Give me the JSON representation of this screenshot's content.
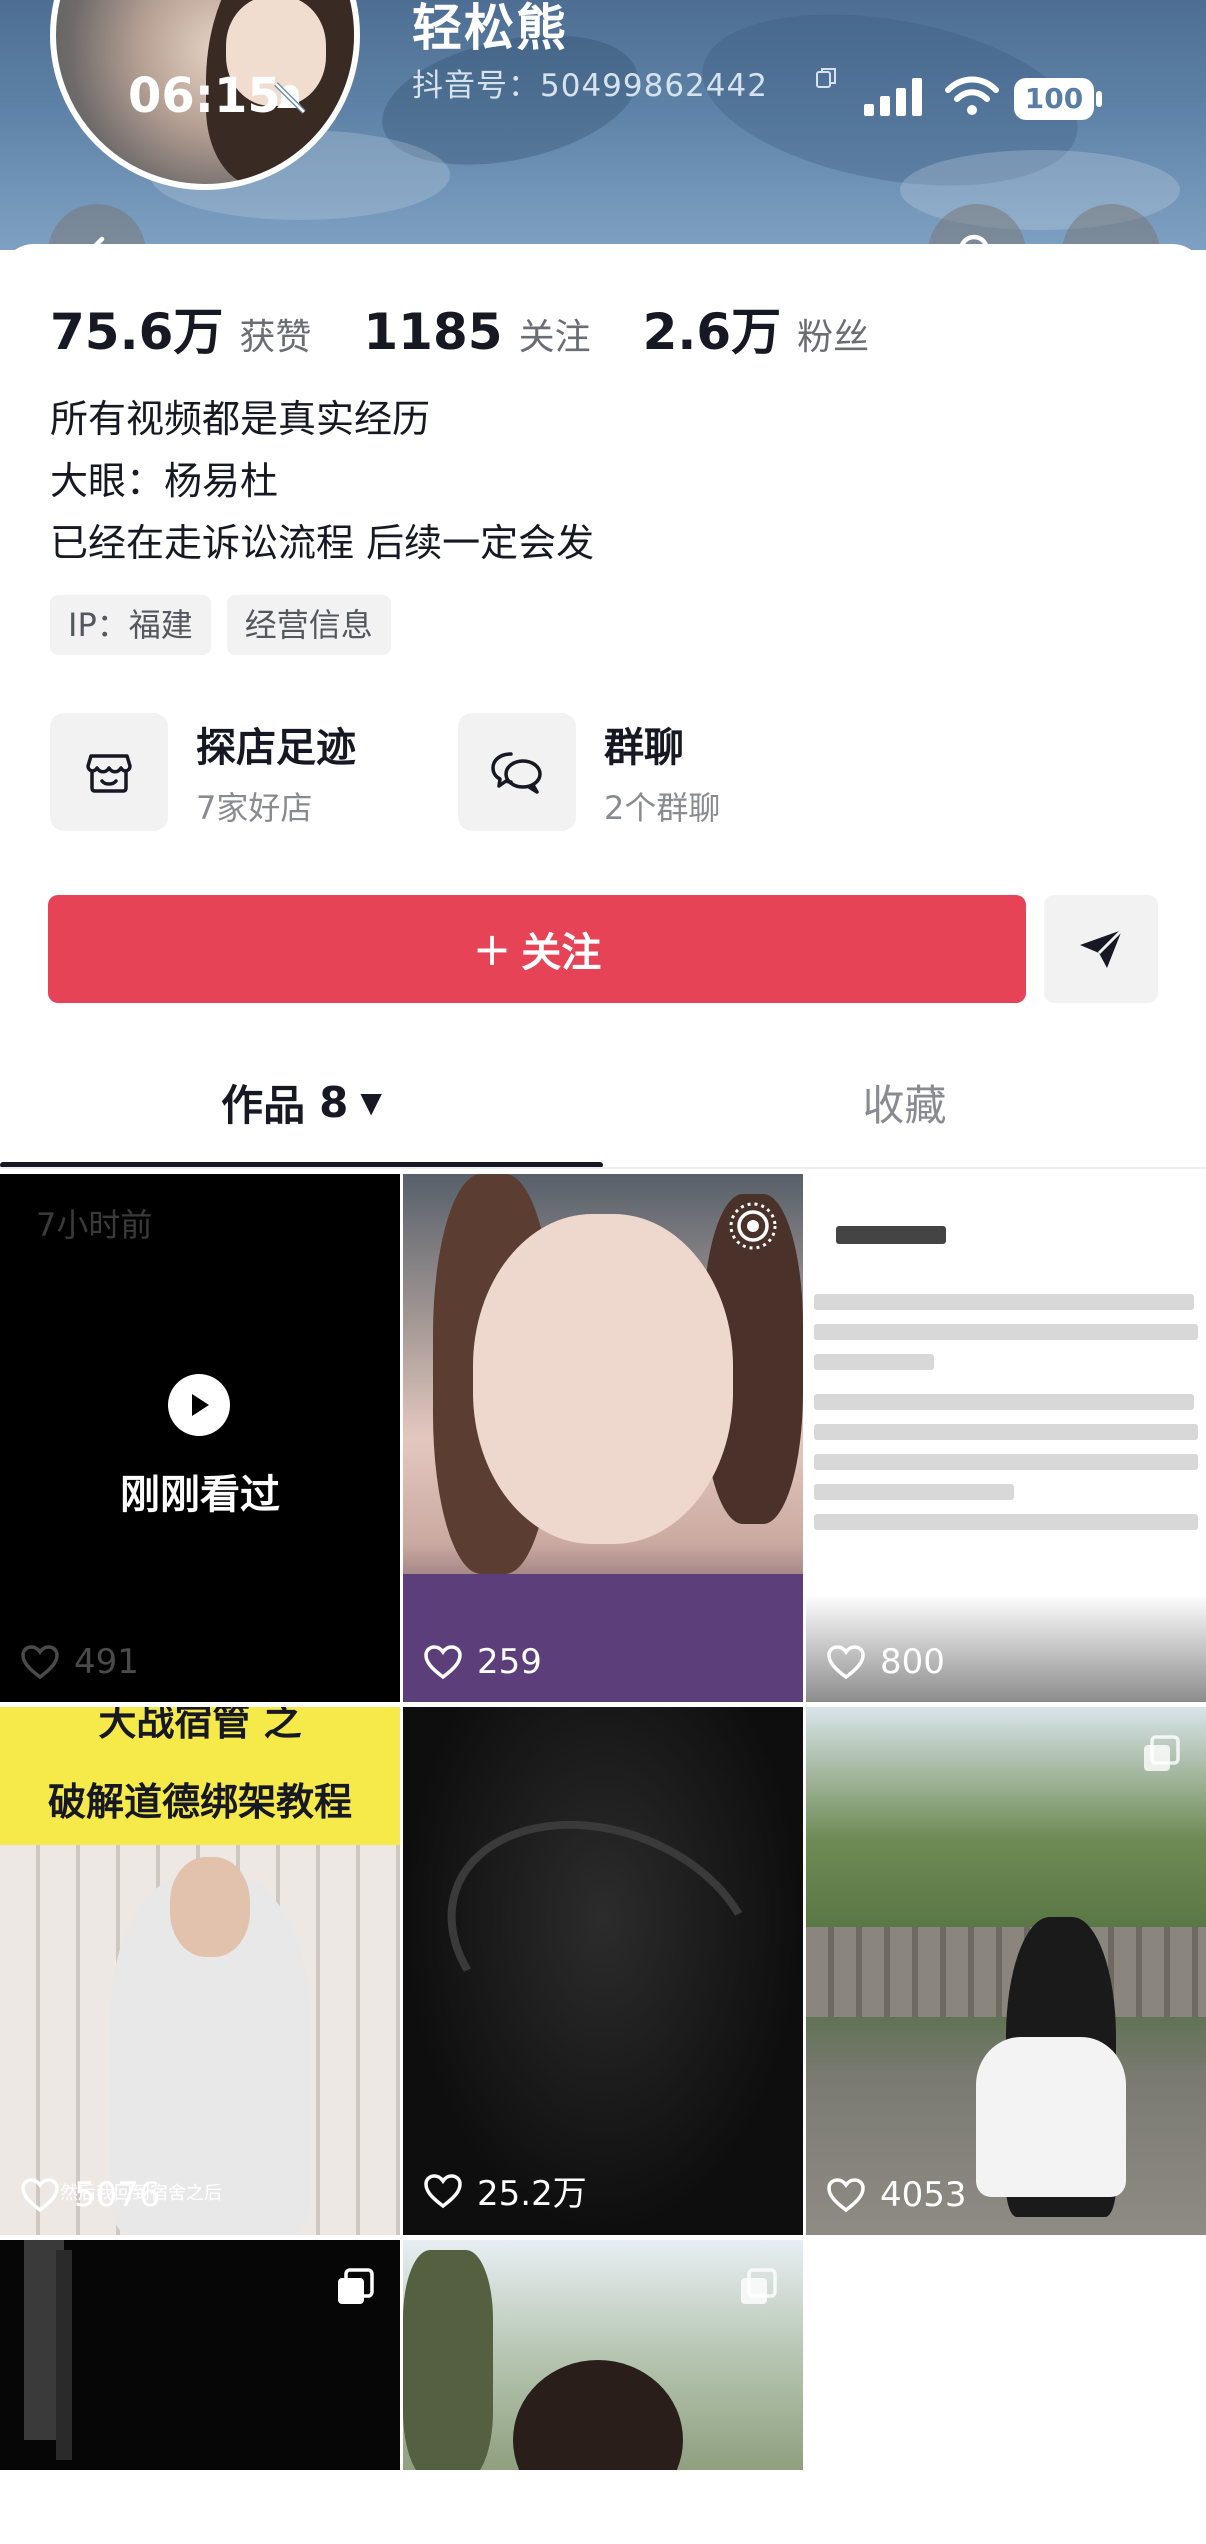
{
  "status_bar": {
    "time": "06:15",
    "battery": "100"
  },
  "profile": {
    "username": "轻松熊",
    "douyin_id": "抖音号：50499862442",
    "stats": [
      {
        "value": "75.6万",
        "label": "获赞"
      },
      {
        "value": "1185",
        "label": "关注"
      },
      {
        "value": "2.6万",
        "label": "粉丝"
      }
    ],
    "bio": [
      "所有视频都是真实经历",
      "大眼：杨易杜",
      "已经在走诉讼流程 后续一定会发"
    ],
    "tags": [
      "IP：福建",
      "经营信息"
    ]
  },
  "shortcuts": [
    {
      "title": "探店足迹",
      "subtitle": "7家好店",
      "icon": "store-icon"
    },
    {
      "title": "群聊",
      "subtitle": "2个群聊",
      "icon": "chat-bubbles-icon"
    }
  ],
  "actions": {
    "follow_plus": "+",
    "follow_label": "关注"
  },
  "tabs": {
    "works_label": "作品",
    "works_count": "8",
    "favorites_label": "收藏"
  },
  "grid": {
    "recent_ago": "7小时前",
    "recent_label": "刚刚看过",
    "items": [
      {
        "likes": "491"
      },
      {
        "likes": "259"
      },
      {
        "likes": "800"
      },
      {
        "likes": "5076",
        "title_line1": "大战宿管",
        "title_line2": "之",
        "title_line3": "破解道德绑架教程",
        "caption": "然后我回到宿舍之后"
      },
      {
        "likes": "25.2万"
      },
      {
        "likes": "4053"
      }
    ]
  },
  "colors": {
    "accent": "#e64456",
    "text": "#161823",
    "muted": "#8a8b91"
  }
}
